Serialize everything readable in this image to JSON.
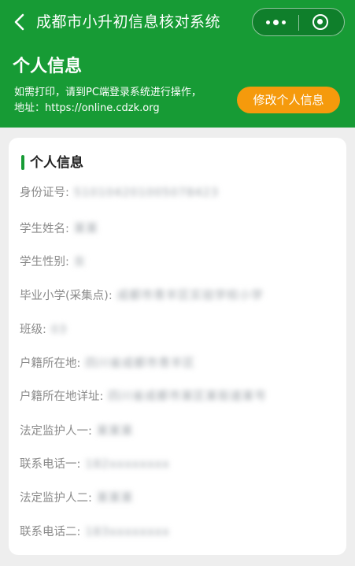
{
  "nav": {
    "title": "成都市小升初信息核对系统",
    "back_icon": "chevron-left-icon",
    "more_icon": "more-dots-icon",
    "close_icon": "target-circle-icon"
  },
  "banner": {
    "title": "个人信息",
    "notice_line1": "如需打印，请到PC端登录系统进行操作，",
    "notice_line2": "地址：https://online.cdzk.org",
    "edit_button": "修改个人信息"
  },
  "card": {
    "title": "个人信息",
    "fields": [
      {
        "label": "身份证号:",
        "value": "510104201005078423"
      },
      {
        "label": "学生姓名:",
        "value": "某某"
      },
      {
        "label": "学生性别:",
        "value": "女"
      },
      {
        "label": "毕业小学(采集点):",
        "value": "成都市青羊区实验学校小学"
      },
      {
        "label": "班级:",
        "value": "03"
      },
      {
        "label": "户籍所在地:",
        "value": "四川省成都市青羊区"
      },
      {
        "label": "户籍所在地详址:",
        "value": "四川省成都市某区某街道某号"
      },
      {
        "label": "法定监护人一:",
        "value": "某某某"
      },
      {
        "label": "联系电话一:",
        "value": "182xxxxxxxx"
      },
      {
        "label": "法定监护人二:",
        "value": "某某某"
      },
      {
        "label": "联系电话二:",
        "value": "183xxxxxxxx"
      }
    ]
  },
  "colors": {
    "primary_green": "#179b35",
    "accent_orange": "#f59a0c",
    "label_gray": "#8a8a8a"
  }
}
